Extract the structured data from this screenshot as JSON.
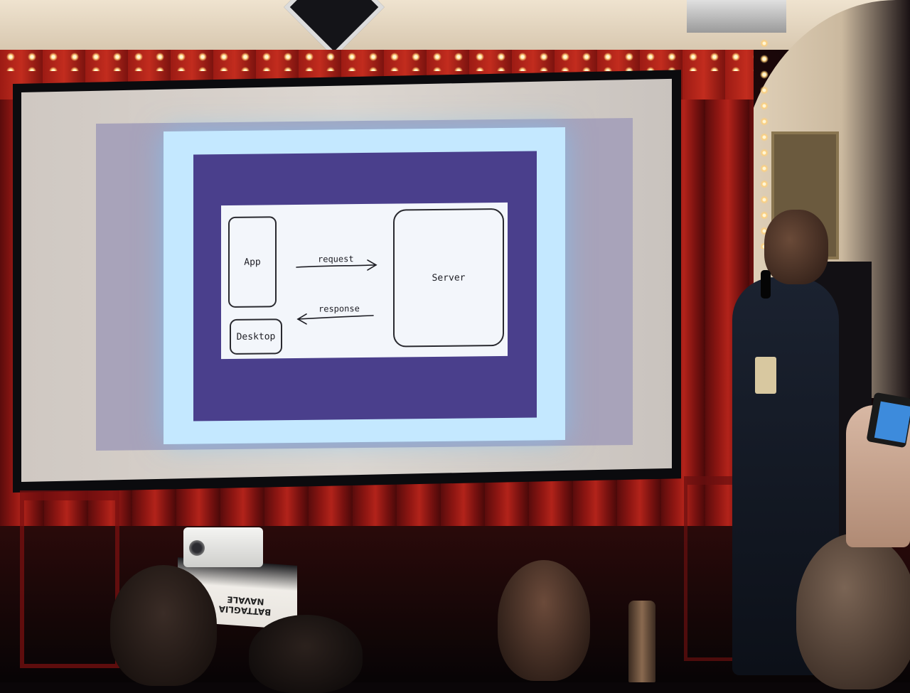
{
  "slide": {
    "app_label": "App",
    "desktop_label": "Desktop",
    "server_label": "Server",
    "request_label": "request",
    "response_label": "response"
  },
  "props": {
    "box_text": "BATTAGLIA NAVALE"
  }
}
